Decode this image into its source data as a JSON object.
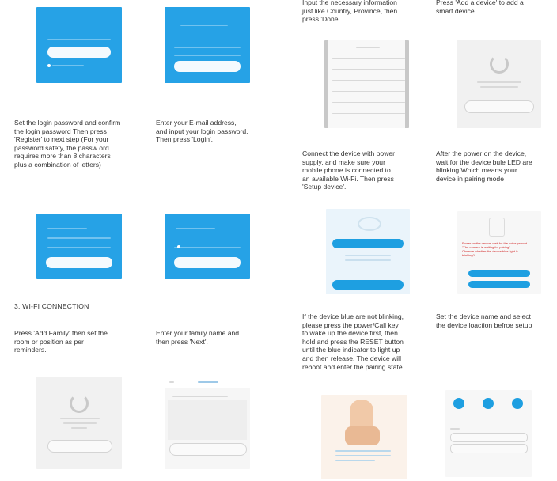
{
  "captions": {
    "c1": "Input the necessary information\njust like Country, Province, then\npress 'Done'.",
    "c2": "Press 'Add a device' to add a\nsmart  device",
    "c3": "Set the login password and confirm\nthe login password Then press\n'Register' to next step  (For your\npassword safety, the passw ord\nrequires more than 8 characters\nplus a combination of letters)",
    "c4": "Enter your E-mail address,\nand input your login password.\nThen press 'Login'.",
    "c5": "Connect the device with power\nsupply, and make sure your\nmobile phone is connected to\nan available Wi-Fi. Then press\n'Setup device'.",
    "c6": "After the power on the device,\nwait for the device bule LED are\nblinking Which means your\ndevice  in pairing  mode",
    "c7": "Press 'Add Family' then set the\nroom or position as per\nreminders.",
    "c8": "Enter your family name and\nthen press 'Next'.",
    "c9": "If the device blue are not blinking,\nplease press the power/Call key\nto wake up the device first, then\nhold and press the RESET button\nuntil the blue indicator to light up\nand then release. The device will\nreboot and enter the pairing state.",
    "c10": "Set the device name and select\nthe device loaction befroe setup"
  },
  "section_heading": "3. WI-FI CONNECTION",
  "screens": {
    "pairing_warning": "Power on the device, wait for the voice prompt\n\"The camera is waiting for pairing\".\nObserve whether the device blue light is\nblinking?"
  },
  "colors": {
    "app_blue": "#26a2e6",
    "warning_red": "#d02020"
  }
}
